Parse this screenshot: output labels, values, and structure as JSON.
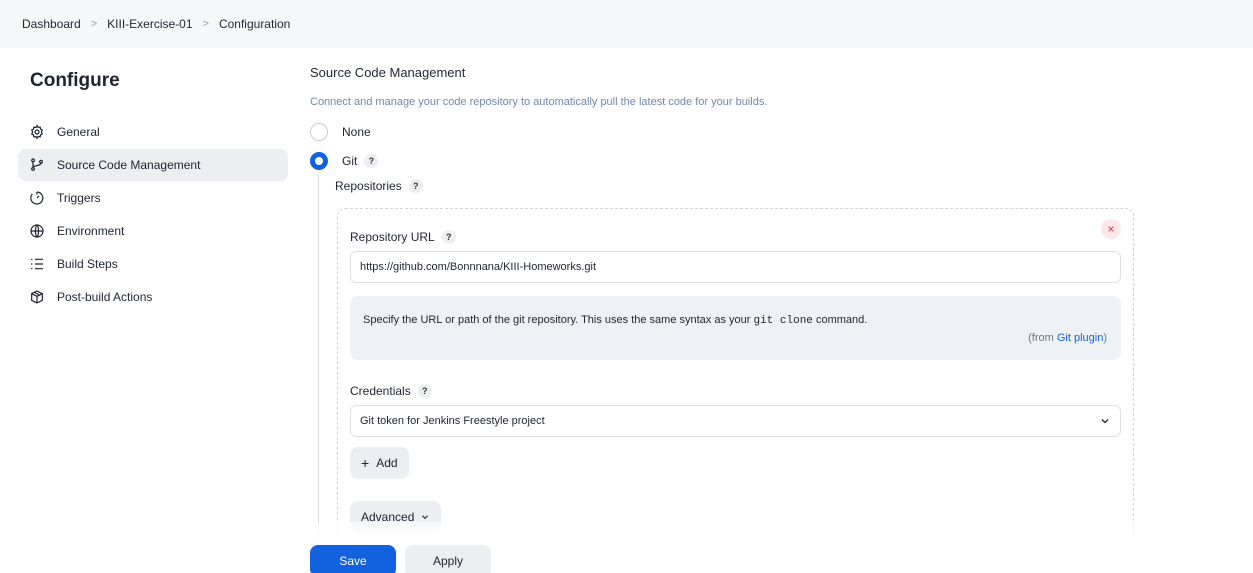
{
  "breadcrumb": [
    "Dashboard",
    "KIII-Exercise-01",
    "Configuration"
  ],
  "sidebar": {
    "title": "Configure",
    "items": [
      {
        "label": "General",
        "icon": "gear-icon"
      },
      {
        "label": "Source Code Management",
        "icon": "branch-icon"
      },
      {
        "label": "Triggers",
        "icon": "timer-icon"
      },
      {
        "label": "Environment",
        "icon": "globe-icon"
      },
      {
        "label": "Build Steps",
        "icon": "list-icon"
      },
      {
        "label": "Post-build Actions",
        "icon": "package-icon"
      }
    ],
    "active_index": 1
  },
  "scm": {
    "title": "Source Code Management",
    "description": "Connect and manage your code repository to automatically pull the latest code for your builds.",
    "options": [
      {
        "label": "None",
        "checked": false
      },
      {
        "label": "Git",
        "checked": true
      }
    ],
    "repositories_label": "Repositories",
    "repo": {
      "url_label": "Repository URL",
      "url_value": "https://github.com/Bonnnana/KIII-Homeworks.git",
      "help_text_before": "Specify the URL or path of the git repository. This uses the same syntax as your ",
      "help_code": "git clone",
      "help_text_after": " command.",
      "from_prefix": "(from ",
      "from_link": "Git plugin",
      "from_suffix": ")",
      "credentials_label": "Credentials",
      "credentials_value": "Git token for Jenkins Freestyle project",
      "add_label": "Add",
      "advanced_label": "Advanced"
    }
  },
  "help_symbol": "?",
  "delete_symbol": "×",
  "actions": {
    "save": "Save",
    "apply": "Apply"
  },
  "colors": {
    "accent": "#1262e0",
    "danger": "#d9323a",
    "description": "#6f88ae"
  }
}
